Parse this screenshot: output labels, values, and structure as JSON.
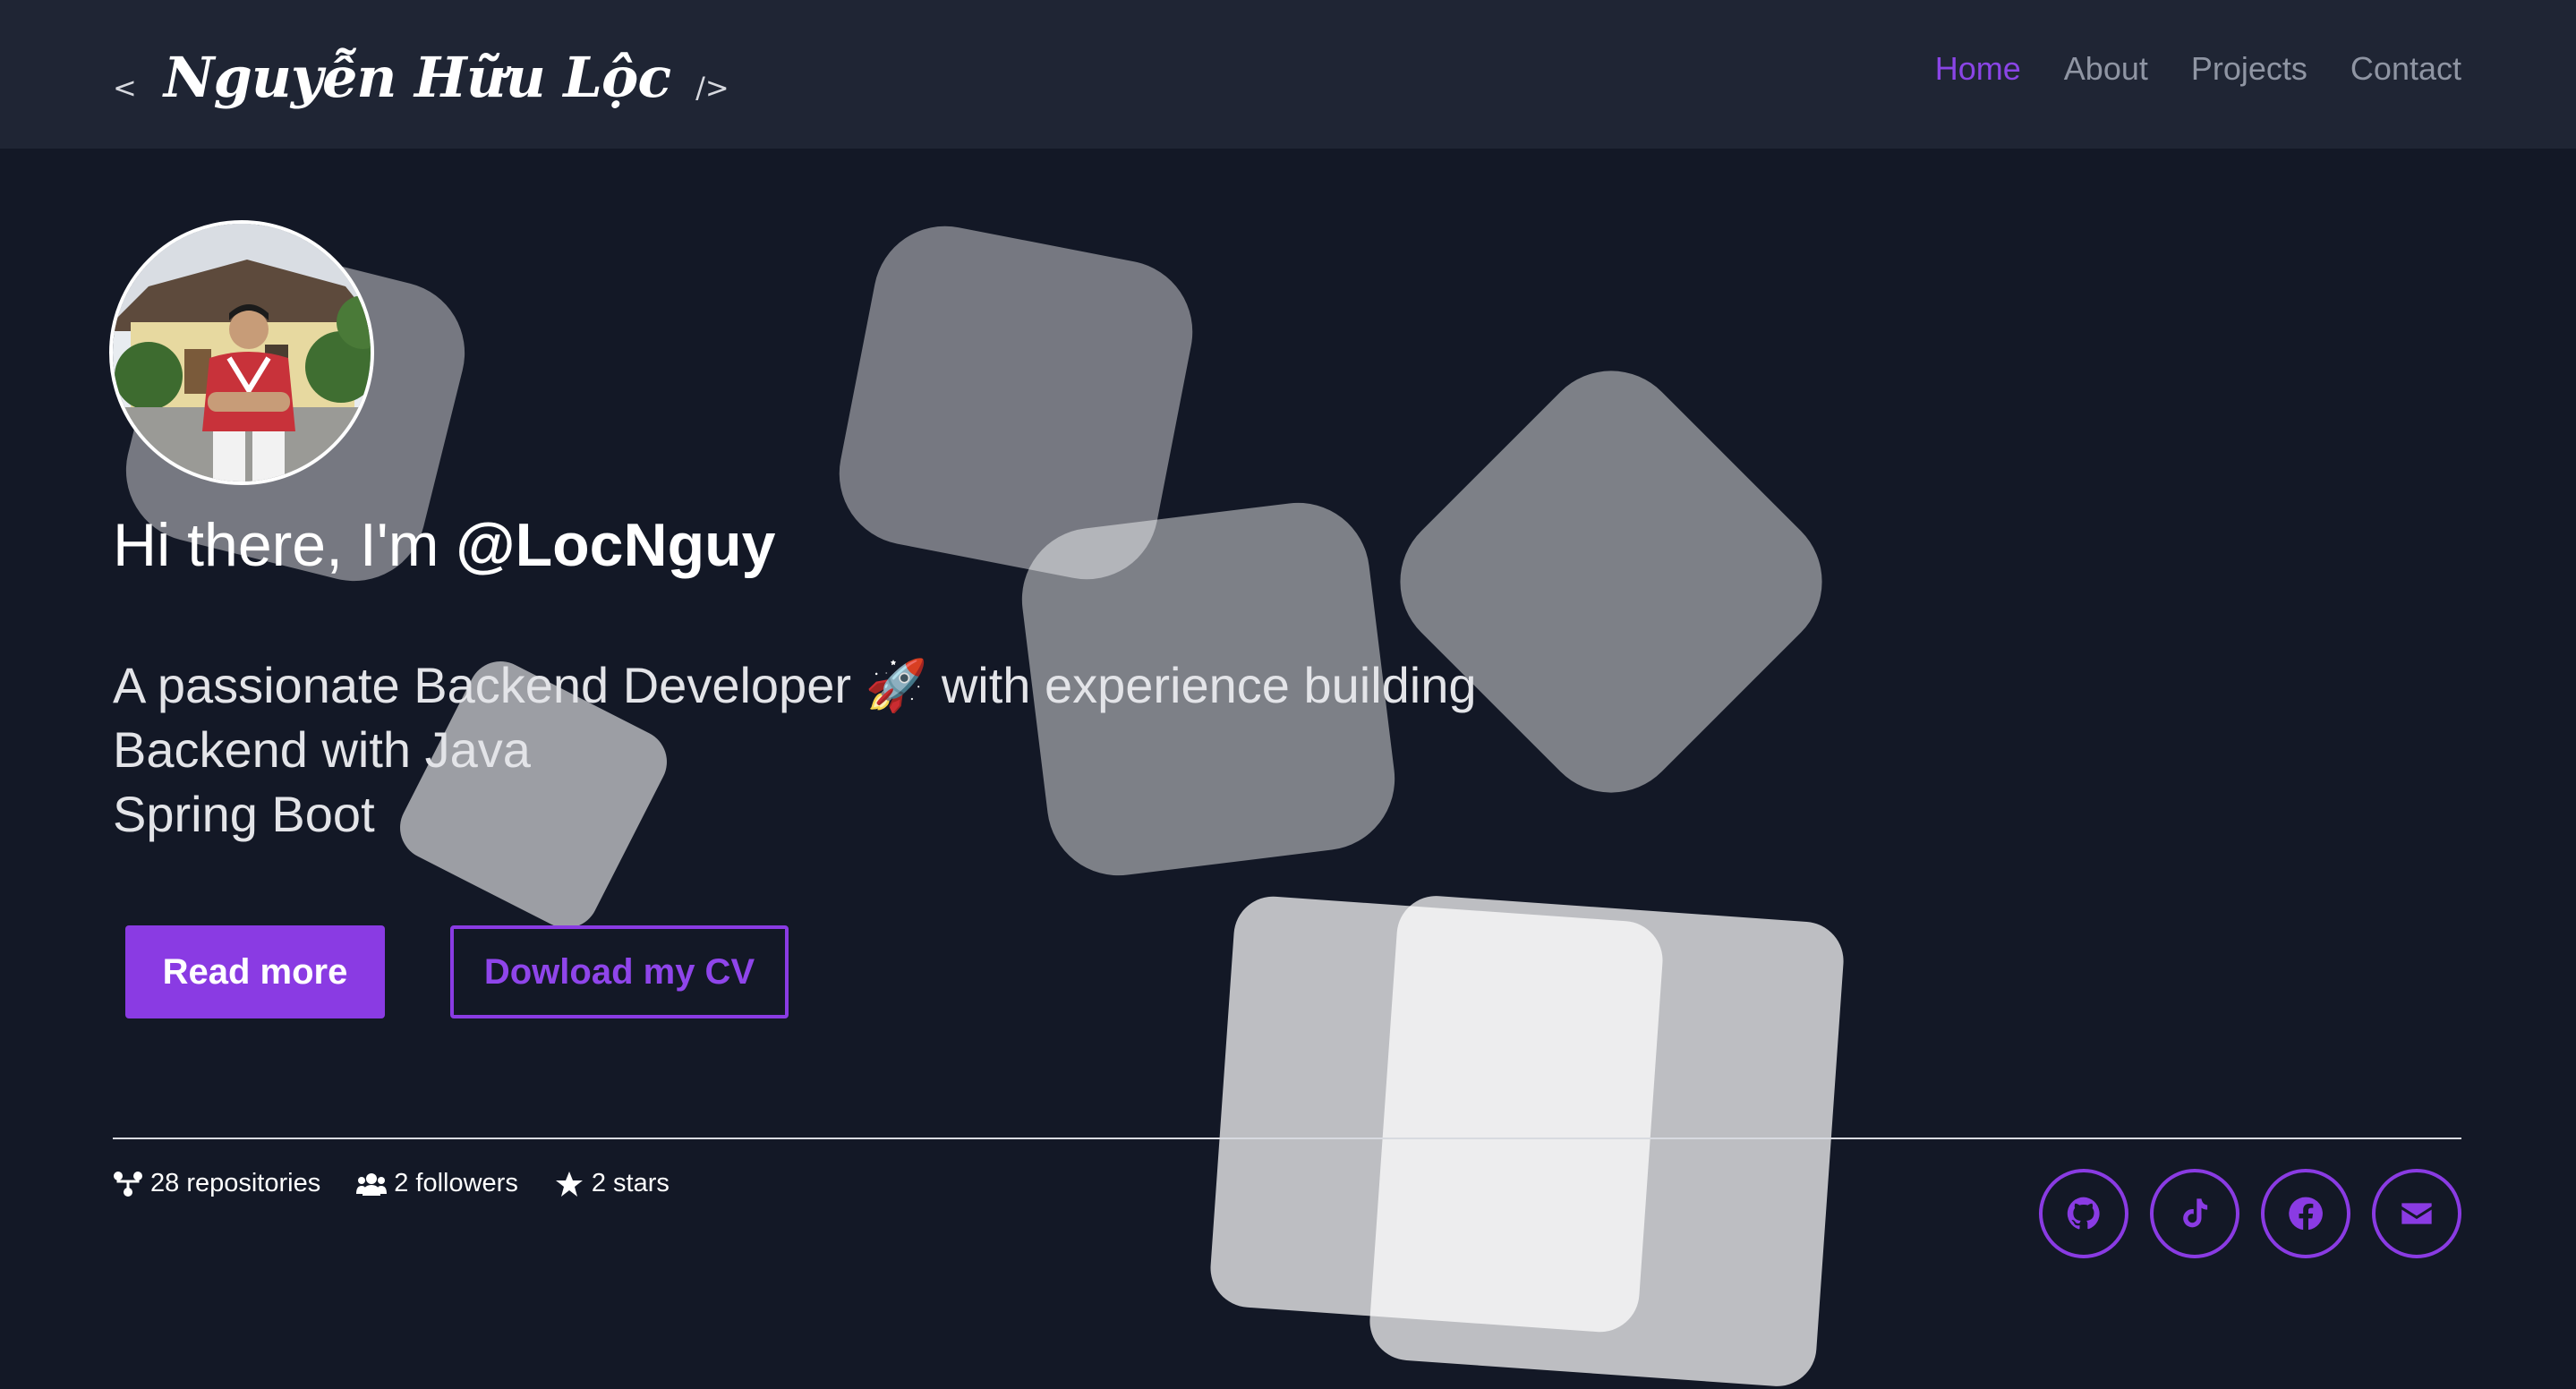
{
  "brand": {
    "open_bracket": "<",
    "name": "Nguyễn Hữu Lộc",
    "close_bracket": "/>"
  },
  "nav": {
    "home": "Home",
    "about": "About",
    "projects": "Projects",
    "contact": "Contact"
  },
  "hero": {
    "greeting_prefix": "Hi there, I'm ",
    "handle": "@LocNguy",
    "tagline_line1": "A passionate Backend Developer 🚀 with experience building",
    "tagline_line2": "Backend with Java",
    "tagline_line3": "Spring Boot",
    "read_more": "Read more",
    "download_cv": "Dowload my CV"
  },
  "stats": {
    "repositories": "28 repositories",
    "followers": "2 followers",
    "stars": "2 stars"
  },
  "socials": [
    "github-icon",
    "tiktok-icon",
    "facebook-icon",
    "email-icon"
  ],
  "colors": {
    "accent": "#8a3be3",
    "background": "#131826",
    "navbar": "#1f2534"
  }
}
